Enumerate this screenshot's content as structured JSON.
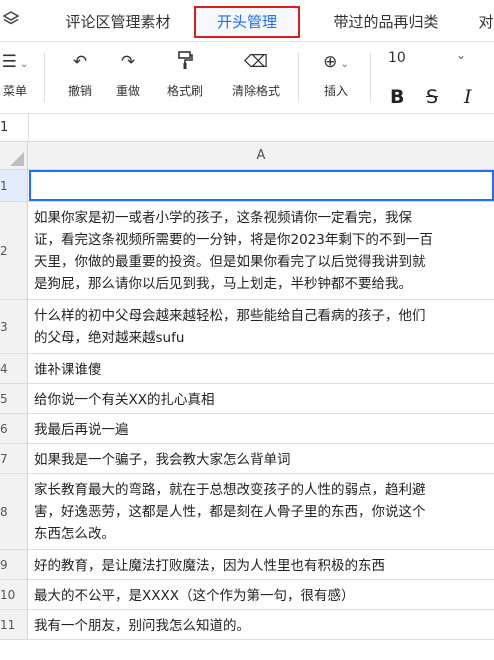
{
  "tabs": {
    "items": [
      {
        "label": "评论区管理素材"
      },
      {
        "label": "开头管理"
      },
      {
        "label": "带过的品再归类"
      },
      {
        "label": "对"
      }
    ]
  },
  "toolbar": {
    "menu_label": "菜单",
    "undo_label": "撤销",
    "redo_label": "重做",
    "format_painter_label": "格式刷",
    "clear_format_label": "清除格式",
    "insert_label": "插入",
    "font_size": "10",
    "bold": "B",
    "strike": "S",
    "italic": "I"
  },
  "refrow": {
    "ref": "1"
  },
  "sheet": {
    "column_header": "A",
    "rows": [
      {
        "num": "1",
        "text": ""
      },
      {
        "num": "2",
        "text": "如果你家是初一或者小学的孩子，这条视频请你一定看完，我保\n证，看完这条视频所需要的一分钟，将是你2023年剩下的不到一百\n天里，你做的最重要的投资。但是如果你看完了以后觉得我讲到就\n是狗屁，那么请你以后见到我，马上划走，半秒钟都不要给我。"
      },
      {
        "num": "3",
        "text": "什么样的初中父母会越来越轻松，那些能给自己看病的孩子，他们\n的父母，绝对越来越sufu"
      },
      {
        "num": "4",
        "text": "谁补课谁傻"
      },
      {
        "num": "5",
        "text": "给你说一个有关XX的扎心真相"
      },
      {
        "num": "6",
        "text": "我最后再说一遍"
      },
      {
        "num": "7",
        "text": "如果我是一个骗子，我会教大家怎么背单词"
      },
      {
        "num": "8",
        "text": "家长教育最大的弯路，就在于总想改变孩子的人性的弱点，趋利避\n害，好逸恶劳，这都是人性，都是刻在人骨子里的东西，你说这个\n东西怎么改。"
      },
      {
        "num": "9",
        "text": "好的教育，是让魔法打败魔法，因为人性里也有积极的东西"
      },
      {
        "num": "10",
        "text": "最大的不公平，是XXXX（这个作为第一句，很有感）"
      },
      {
        "num": "11",
        "text": "我有一个朋友，别问我怎么知道的。"
      }
    ]
  }
}
